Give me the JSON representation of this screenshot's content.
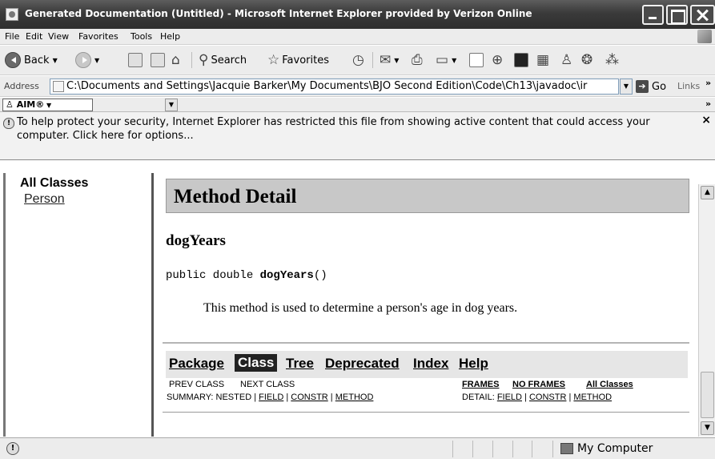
{
  "window": {
    "title": "Generated Documentation (Untitled) - Microsoft Internet Explorer provided by Verizon Online"
  },
  "menu": [
    "File",
    "Edit",
    "View",
    "Favorites",
    "Tools",
    "Help"
  ],
  "toolbar": {
    "back_label": "Back",
    "search_label": "Search",
    "favorites_label": "Favorites"
  },
  "address": {
    "label": "Address",
    "url": "C:\\Documents and Settings\\Jacquie Barker\\My Documents\\BJO Second Edition\\Code\\Ch13\\javadoc\\ir",
    "go_label": "Go",
    "links_label": "Links",
    "more": "»"
  },
  "aim": {
    "label": "AIM®"
  },
  "infobar": {
    "message": "To help protect your security, Internet Explorer has restricted this file from showing active content that could access your computer. Click here for options...",
    "close": "×"
  },
  "left_frame": {
    "heading": "All Classes",
    "classes": [
      "Person"
    ]
  },
  "main": {
    "section_title": "Method Detail",
    "method_name": "dogYears",
    "signature_prefix": "public double ",
    "signature_name": "dogYears",
    "signature_suffix": "()",
    "description": "This method is used to determine a person's age in dog years.",
    "nav": [
      "Package",
      "Class",
      "Tree",
      "Deprecated",
      "Index",
      "Help"
    ],
    "prev_class": "PREV CLASS",
    "next_class": "NEXT CLASS",
    "frames": "FRAMES",
    "no_frames": "NO FRAMES",
    "all_classes": "All Classes",
    "summary_label": "SUMMARY: NESTED | ",
    "summary_field": "FIELD",
    "summary_constr": "CONSTR",
    "summary_method": "METHOD",
    "detail_label": "DETAIL: ",
    "detail_field": "FIELD",
    "detail_constr": "CONSTR",
    "detail_method": "METHOD",
    "pipe": " | "
  },
  "status": {
    "zone": "My Computer"
  }
}
